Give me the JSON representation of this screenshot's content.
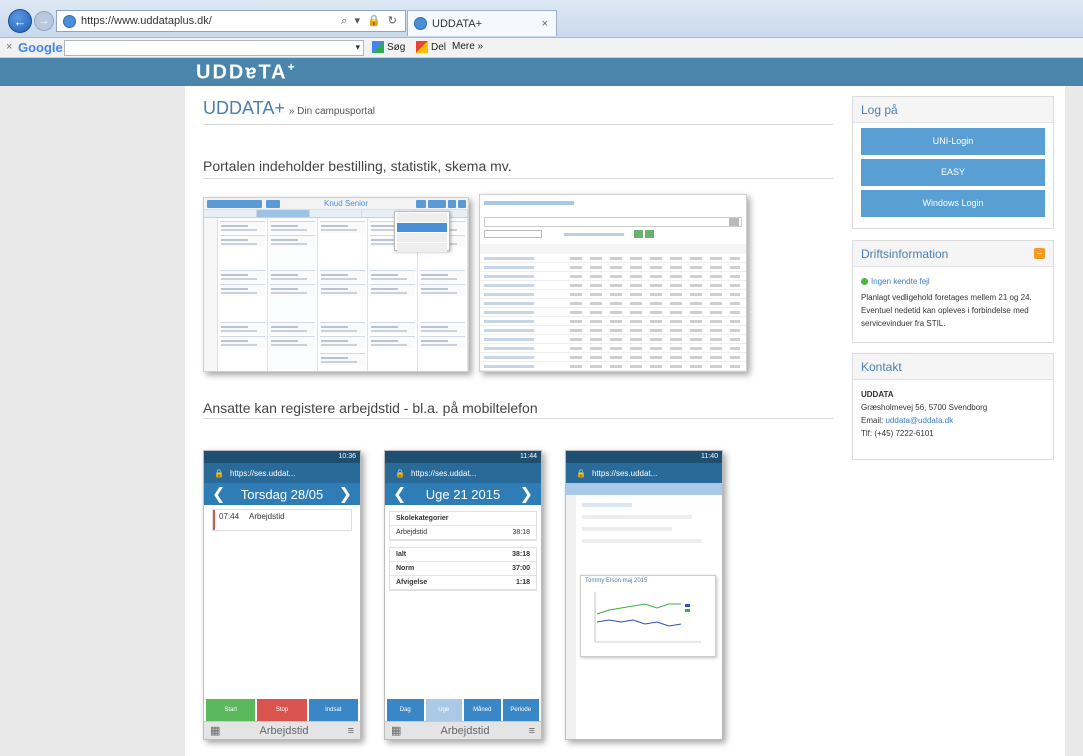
{
  "browser": {
    "url": "https://www.uddataplus.dk/",
    "address_tools": "⌕ ▾ 🔒 ↻",
    "tab_title": "UDDATA+",
    "tab_close": "×",
    "nav_back": "←",
    "nav_forward": "→"
  },
  "google_bar": {
    "close": "×",
    "logo": "Google",
    "search_dropdown": "▾",
    "search_label": "Søg",
    "share_label": "Del",
    "more_label": "Mere »"
  },
  "site": {
    "logo": "UDDɐTA",
    "logo_plus": "+",
    "brand": "UDDATA+",
    "brand_sub": "» Din campusportal"
  },
  "sections": [
    {
      "title": "Portalen indeholder bestilling, statistik, skema mv."
    },
    {
      "title": "Ansatte kan registere arbejdstid - bl.a. på mobiltelefon"
    }
  ],
  "calendar_shot": {
    "title": "Knud Senior"
  },
  "phone1": {
    "status": "10:36",
    "url": "https://ses.uddat...",
    "title": "Torsdag 28/05",
    "entry_time": "07:44",
    "entry_label": "Arbejdstid",
    "buttons": [
      "Start",
      "Stop",
      "Indsat"
    ],
    "footer": "Arbejdstid"
  },
  "phone2": {
    "status": "11:44",
    "url": "https://ses.uddat...",
    "title": "Uge 21 2015",
    "section_label": "Skolekategorier",
    "rows": [
      {
        "label": "Arbejdstid",
        "value": "38:18"
      }
    ],
    "totals": [
      {
        "label": "Ialt",
        "value": "38:18"
      },
      {
        "label": "Norm",
        "value": "37:00"
      },
      {
        "label": "Afvigelse",
        "value": "1:18"
      }
    ],
    "buttons": [
      "Dag",
      "Uge",
      "Måned",
      "Periode"
    ],
    "footer": "Arbejdstid"
  },
  "phone3": {
    "status": "11:40",
    "url": "https://ses.uddat...",
    "chart_title": "Tommy Elson maj 2015"
  },
  "login": {
    "title": "Log på",
    "buttons": [
      "UNI-Login",
      "EASY",
      "Windows Login"
    ]
  },
  "driftsinformation": {
    "title": "Driftsinformation",
    "status": "Ingen kendte fejl",
    "text": "Planlagt vedligehold foretages mellem 21 og 24. Eventuel nedetid kan opleves i forbindelse med servicevinduer fra STIL."
  },
  "kontakt": {
    "title": "Kontakt",
    "org": "UDDATA",
    "address": "Græsholmevej 56, 5700 Svendborg",
    "email_label": "Email:",
    "email": "uddata@uddata.dk",
    "phone": "Tlf: (+45) 7222-6101"
  },
  "colors": {
    "header": "#4a86ac",
    "accent": "#5a9fd4",
    "brand": "#4b7fb0",
    "ok": "#4bb543",
    "rss": "#f29a1f"
  }
}
